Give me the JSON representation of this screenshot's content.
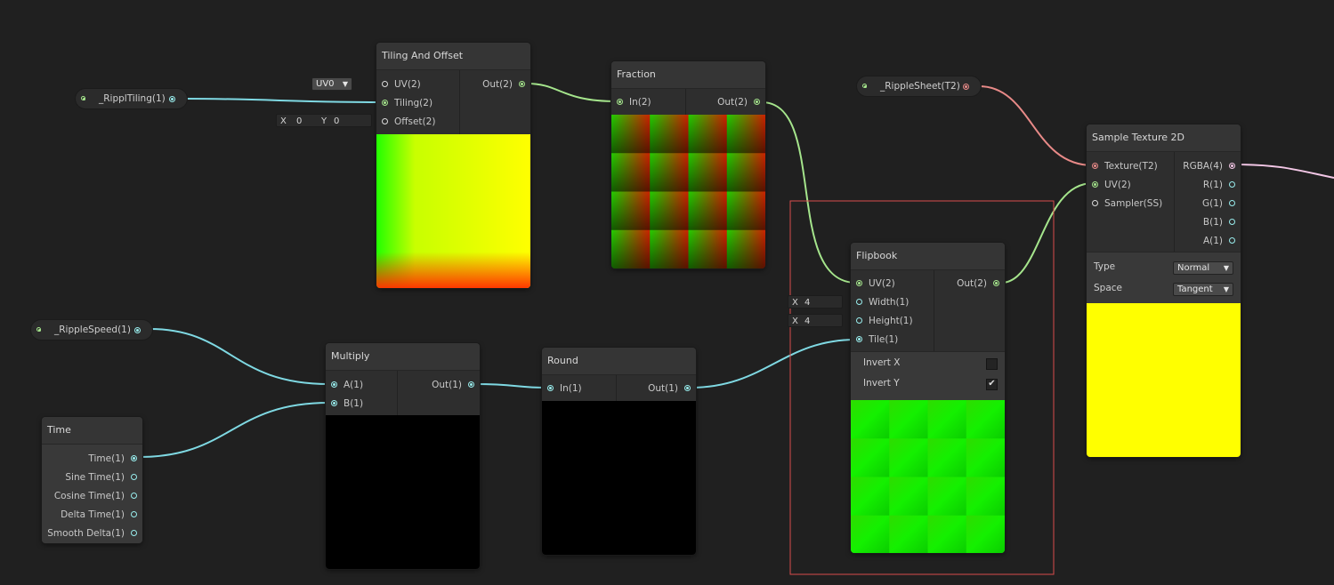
{
  "colors": {
    "background": "#202020",
    "wire_vector2": "#a5e58c",
    "wire_vector1": "#7fd9e3",
    "wire_texture": "#e88a88",
    "wire_vector4": "#f3c7e6",
    "selection": "#d94b4b"
  },
  "properties": {
    "ripple_tiling": "_RipplTiling(1)",
    "ripple_speed": "_RippleSpeed(1)",
    "ripple_sheet": "_RippleSheet(T2)"
  },
  "tiling_offset": {
    "title": "Tiling And Offset",
    "inputs": [
      "UV(2)",
      "Tiling(2)",
      "Offset(2)"
    ],
    "output": "Out(2)",
    "uv_channel": "UV0",
    "offset_x_label": "X",
    "offset_x": "0",
    "offset_y_label": "Y",
    "offset_y": "0"
  },
  "fraction": {
    "title": "Fraction",
    "input": "In(2)",
    "output": "Out(2)"
  },
  "flipbook": {
    "title": "Flipbook",
    "inputs": [
      "UV(2)",
      "Width(1)",
      "Height(1)",
      "Tile(1)"
    ],
    "output": "Out(2)",
    "width_label": "X",
    "width_value": "4",
    "height_label": "X",
    "height_value": "4",
    "invert_x_label": "Invert X",
    "invert_x": false,
    "invert_y_label": "Invert Y",
    "invert_y": true,
    "invert_y_mark": "✔"
  },
  "sample_texture": {
    "title": "Sample Texture 2D",
    "inputs": [
      "Texture(T2)",
      "UV(2)",
      "Sampler(SS)"
    ],
    "outputs": [
      "RGBA(4)",
      "R(1)",
      "G(1)",
      "B(1)",
      "A(1)"
    ],
    "type_label": "Type",
    "type_value": "Normal",
    "space_label": "Space",
    "space_value": "Tangent"
  },
  "multiply": {
    "title": "Multiply",
    "inputs": [
      "A(1)",
      "B(1)"
    ],
    "output": "Out(1)"
  },
  "round": {
    "title": "Round",
    "input": "In(1)",
    "output": "Out(1)"
  },
  "time": {
    "title": "Time",
    "outputs": [
      "Time(1)",
      "Sine Time(1)",
      "Cosine Time(1)",
      "Delta Time(1)",
      "Smooth Delta(1)"
    ]
  }
}
